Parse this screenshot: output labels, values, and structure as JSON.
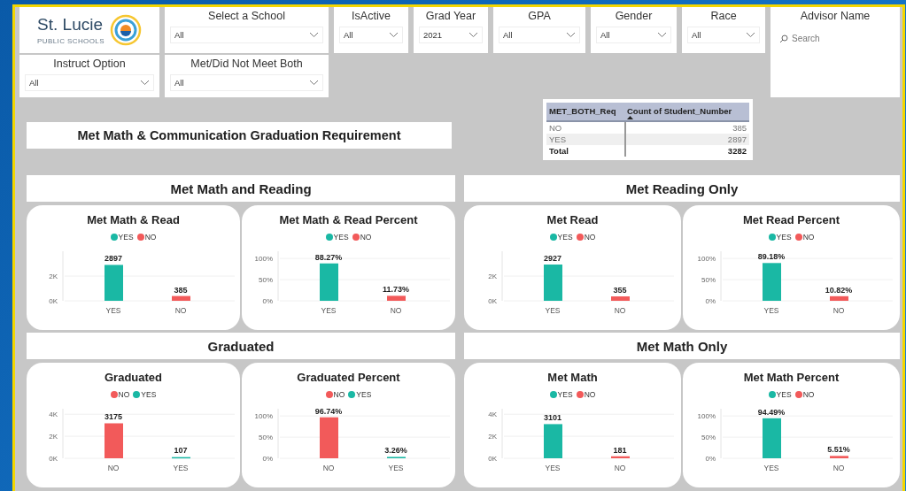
{
  "logo": {
    "name": "St. Lucie",
    "subtitle": "PUBLIC SCHOOLS"
  },
  "top_filters": [
    {
      "kind": "dropdown",
      "label": "Select a School",
      "value": "All"
    },
    {
      "kind": "dropdown",
      "label": "IsActive",
      "value": "All"
    },
    {
      "kind": "dropdown",
      "label": "Grad Year",
      "value": "2021"
    },
    {
      "kind": "dropdown",
      "label": "GPA",
      "value": "All"
    },
    {
      "kind": "dropdown",
      "label": "Gender",
      "value": "All"
    },
    {
      "kind": "dropdown",
      "label": "Race",
      "value": "All"
    },
    {
      "kind": "search",
      "label": "Advisor Name",
      "placeholder": "Search"
    }
  ],
  "bottom_filters": [
    {
      "kind": "dropdown",
      "label": "Instruct Option",
      "value": "All"
    },
    {
      "kind": "dropdown",
      "label": "Met/Did Not Meet Both",
      "value": "All"
    }
  ],
  "requirement_title": "Met Math & Communication Graduation Requirement",
  "summary_table": {
    "columns": [
      {
        "label": "MET_BOTH_Req",
        "sorted": false
      },
      {
        "label": "Count of Student_Number",
        "sorted": true
      }
    ],
    "rows": [
      [
        "NO",
        "385"
      ],
      [
        "YES",
        "2897"
      ]
    ],
    "total": [
      "Total",
      "3282"
    ]
  },
  "sections": [
    {
      "title": "Met Math and Reading",
      "charts": [
        {
          "title": "Met Math & Read",
          "chart_data": {
            "type": "bar",
            "categories": [
              "YES",
              "NO"
            ],
            "series": [
              {
                "name": "YES",
                "color": "#1ab8a4",
                "values": [
                  2897,
                  null
                ]
              },
              {
                "name": "NO",
                "color": "#f25a5a",
                "values": [
                  null,
                  385
                ]
              }
            ],
            "stacked": true,
            "ylim": [
              0,
              4000
            ],
            "yticks": [
              {
                "value": 0,
                "label": "0K"
              },
              {
                "value": 2000,
                "label": "2K"
              }
            ],
            "value_labels": [
              "2897",
              "385"
            ]
          }
        },
        {
          "title": "Met Math & Read Percent",
          "chart_data": {
            "type": "bar",
            "categories": [
              "YES",
              "NO"
            ],
            "series": [
              {
                "name": "YES",
                "color": "#1ab8a4",
                "values": [
                  88.27,
                  null
                ]
              },
              {
                "name": "NO",
                "color": "#f25a5a",
                "values": [
                  null,
                  11.73
                ]
              }
            ],
            "stacked": true,
            "ylim": [
              0,
              117
            ],
            "yticks": [
              {
                "value": 0,
                "label": "0%"
              },
              {
                "value": 50,
                "label": "50%"
              },
              {
                "value": 100,
                "label": "100%"
              }
            ],
            "value_labels": [
              "88.27%",
              "11.73%"
            ]
          }
        }
      ]
    },
    {
      "title": "Met Reading Only",
      "charts": [
        {
          "title": "Met Read",
          "chart_data": {
            "type": "bar",
            "categories": [
              "YES",
              "NO"
            ],
            "series": [
              {
                "name": "YES",
                "color": "#1ab8a4",
                "values": [
                  2927,
                  null
                ]
              },
              {
                "name": "NO",
                "color": "#f25a5a",
                "values": [
                  null,
                  355
                ]
              }
            ],
            "stacked": true,
            "ylim": [
              0,
              4000
            ],
            "yticks": [
              {
                "value": 0,
                "label": "0K"
              },
              {
                "value": 2000,
                "label": "2K"
              }
            ],
            "value_labels": [
              "2927",
              "355"
            ]
          }
        },
        {
          "title": "Met Read Percent",
          "chart_data": {
            "type": "bar",
            "categories": [
              "YES",
              "NO"
            ],
            "series": [
              {
                "name": "YES",
                "color": "#1ab8a4",
                "values": [
                  89.18,
                  null
                ]
              },
              {
                "name": "NO",
                "color": "#f25a5a",
                "values": [
                  null,
                  10.82
                ]
              }
            ],
            "stacked": true,
            "ylim": [
              0,
              117
            ],
            "yticks": [
              {
                "value": 0,
                "label": "0%"
              },
              {
                "value": 50,
                "label": "50%"
              },
              {
                "value": 100,
                "label": "100%"
              }
            ],
            "value_labels": [
              "89.18%",
              "10.82%"
            ]
          }
        }
      ]
    },
    {
      "title": "Graduated",
      "charts": [
        {
          "title": "Graduated",
          "chart_data": {
            "type": "bar",
            "categories": [
              "NO",
              "YES"
            ],
            "series": [
              {
                "name": "NO",
                "color": "#f25a5a",
                "values": [
                  3175,
                  null
                ]
              },
              {
                "name": "YES",
                "color": "#1ab8a4",
                "values": [
                  null,
                  107
                ]
              }
            ],
            "stacked": true,
            "ylim": [
              0,
              4500
            ],
            "yticks": [
              {
                "value": 0,
                "label": "0K"
              },
              {
                "value": 2000,
                "label": "2K"
              },
              {
                "value": 4000,
                "label": "4K"
              }
            ],
            "value_labels": [
              "3175",
              "107"
            ]
          }
        },
        {
          "title": "Graduated Percent",
          "chart_data": {
            "type": "bar",
            "categories": [
              "NO",
              "YES"
            ],
            "series": [
              {
                "name": "NO",
                "color": "#f25a5a",
                "values": [
                  96.74,
                  null
                ]
              },
              {
                "name": "YES",
                "color": "#1ab8a4",
                "values": [
                  null,
                  3.26
                ]
              }
            ],
            "stacked": true,
            "ylim": [
              0,
              117
            ],
            "yticks": [
              {
                "value": 0,
                "label": "0%"
              },
              {
                "value": 50,
                "label": "50%"
              },
              {
                "value": 100,
                "label": "100%"
              }
            ],
            "value_labels": [
              "96.74%",
              "3.26%"
            ]
          }
        }
      ]
    },
    {
      "title": "Met Math Only",
      "charts": [
        {
          "title": "Met Math",
          "chart_data": {
            "type": "bar",
            "categories": [
              "YES",
              "NO"
            ],
            "series": [
              {
                "name": "YES",
                "color": "#1ab8a4",
                "values": [
                  3101,
                  null
                ]
              },
              {
                "name": "NO",
                "color": "#f25a5a",
                "values": [
                  null,
                  181
                ]
              }
            ],
            "stacked": true,
            "ylim": [
              0,
              4500
            ],
            "yticks": [
              {
                "value": 0,
                "label": "0K"
              },
              {
                "value": 2000,
                "label": "2K"
              },
              {
                "value": 4000,
                "label": "4K"
              }
            ],
            "value_labels": [
              "3101",
              "181"
            ]
          }
        },
        {
          "title": "Met Math Percent",
          "chart_data": {
            "type": "bar",
            "categories": [
              "YES",
              "NO"
            ],
            "series": [
              {
                "name": "YES",
                "color": "#1ab8a4",
                "values": [
                  94.49,
                  null
                ]
              },
              {
                "name": "NO",
                "color": "#f25a5a",
                "values": [
                  null,
                  5.51
                ]
              }
            ],
            "stacked": true,
            "ylim": [
              0,
              117
            ],
            "yticks": [
              {
                "value": 0,
                "label": "0%"
              },
              {
                "value": 50,
                "label": "50%"
              },
              {
                "value": 100,
                "label": "100%"
              }
            ],
            "value_labels": [
              "94.49%",
              "5.51%"
            ]
          }
        }
      ]
    }
  ]
}
